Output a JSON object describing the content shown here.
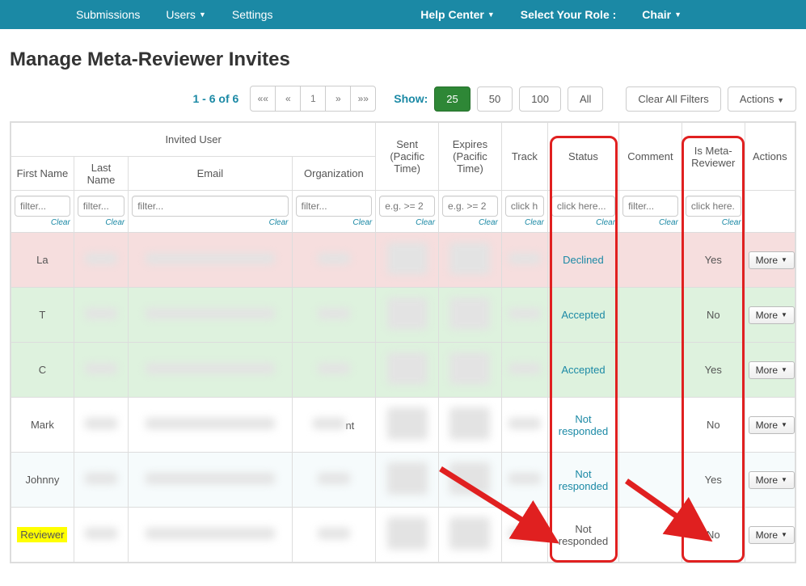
{
  "nav": {
    "left": [
      "Submissions",
      "Users",
      "Settings"
    ],
    "help": "Help Center",
    "select_role": "Select Your Role :",
    "role_value": "Chair"
  },
  "title": "Manage Meta-Reviewer Invites",
  "toolbar": {
    "range": "1 - 6 of 6",
    "pager": {
      "first": "««",
      "prev": "«",
      "page": "1",
      "next": "»",
      "last": "»»"
    },
    "show_label": "Show:",
    "sizes": [
      "25",
      "50",
      "100",
      "All"
    ],
    "active_size": "25",
    "clear_filters": "Clear All Filters",
    "actions": "Actions"
  },
  "headers": {
    "invited_user": "Invited User",
    "first_name": "First Name",
    "last_name": "Last Name",
    "email": "Email",
    "organization": "Organization",
    "sent": "Sent (Pacific Time)",
    "expires": "Expires (Pacific Time)",
    "track": "Track",
    "status": "Status",
    "comment": "Comment",
    "is_meta": "Is Meta-Reviewer",
    "actions": "Actions"
  },
  "filters": {
    "text_ph": "filter...",
    "date_ph": "e.g. >= 2",
    "click_ph": "click here...",
    "click_ph_short": "click h",
    "click_ph_narrow": "click here.",
    "clear": "Clear"
  },
  "rows": [
    {
      "first": "La",
      "status": "Declined",
      "is_meta": "Yes",
      "class": "declined",
      "status_link": true
    },
    {
      "first": "T",
      "status": "Accepted",
      "is_meta": "No",
      "class": "accepted",
      "status_link": true
    },
    {
      "first": "C",
      "status": "Accepted",
      "is_meta": "Yes",
      "class": "accepted",
      "status_link": true
    },
    {
      "first": "Mark",
      "status": "Not responded",
      "is_meta": "No",
      "class": "",
      "status_link": true
    },
    {
      "first": "Johnny",
      "status": "Not responded",
      "is_meta": "Yes",
      "class": "alt",
      "status_link": true
    },
    {
      "first": "Reviewer",
      "status": "Not responded",
      "is_meta": "No",
      "class": "",
      "status_link": false,
      "highlight_first": true
    }
  ],
  "more_label": "More",
  "chart_data": null
}
